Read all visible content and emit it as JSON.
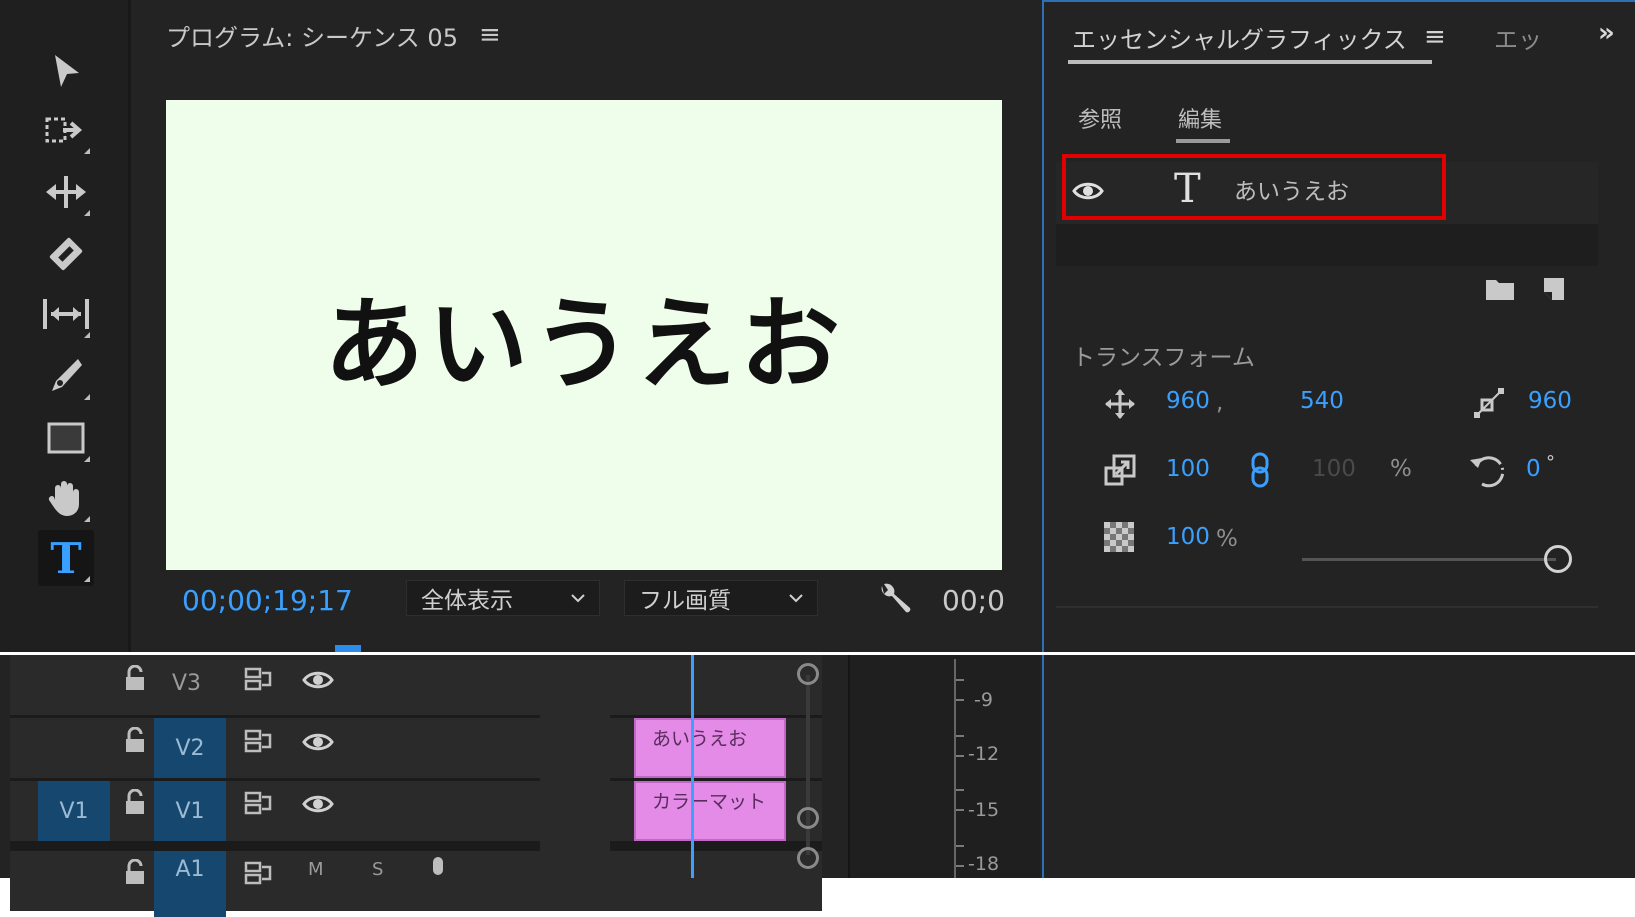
{
  "monitor": {
    "title": "プログラム: シーケンス 05",
    "menu_glyph": "≡",
    "canvas_text": "あいうえお",
    "timecode": "00;00;19;17",
    "zoom_select": "全体表示",
    "quality_select": "フル画質",
    "timecode_right": "00;0"
  },
  "essential_graphics": {
    "title": "エッセンシャルグラフィックス",
    "menu_glyph": "≡",
    "second_tab": "エッ",
    "more_glyph": "»",
    "tabs": {
      "browse": "参照",
      "edit": "編集"
    },
    "layer": {
      "name": "あいうえお",
      "type_glyph": "T"
    },
    "transform": {
      "section_label": "トランスフォーム",
      "position_x": "960",
      "position_sep": ",",
      "position_y": "540",
      "anchor_x": "960",
      "scale": "100",
      "scale_linked": "100",
      "scale_unit": "%",
      "rotation": "0",
      "rotation_unit": "°",
      "opacity": "100",
      "opacity_unit": "%"
    }
  },
  "timeline": {
    "tracks": [
      {
        "label": "V3"
      },
      {
        "label": "V2"
      },
      {
        "label": "V1",
        "source": "V1"
      },
      {
        "label": "A1"
      }
    ],
    "clips": [
      {
        "name": "あいうえお",
        "track": "V2"
      },
      {
        "name": "カラーマット",
        "track": "V1"
      }
    ],
    "audio_buttons": {
      "mute": "M",
      "solo": "S"
    },
    "meter_labels": [
      "-9",
      "-12",
      "-15",
      "-18"
    ]
  },
  "colors": {
    "accent_blue": "#3aa0ff",
    "highlight_red": "#e00000",
    "clip_pink": "#e38be7",
    "canvas_bg": "#eefeea"
  }
}
